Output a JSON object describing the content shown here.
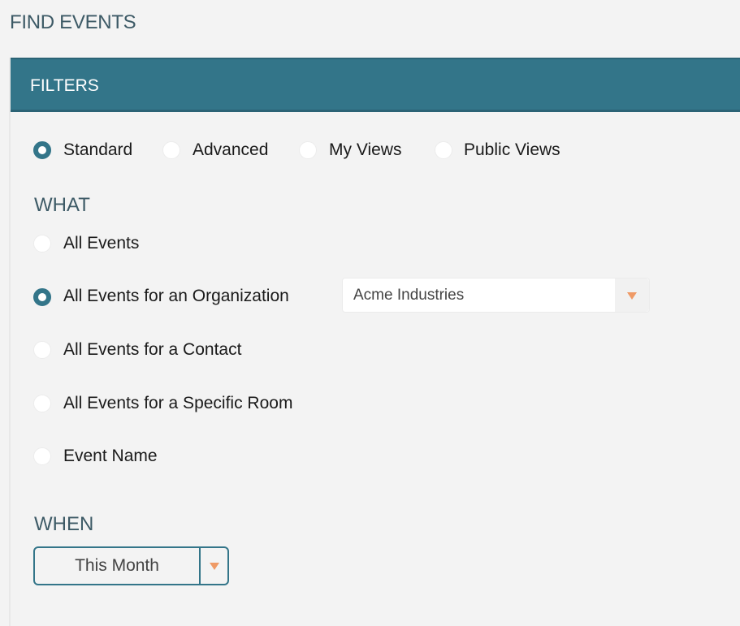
{
  "page": {
    "title": "FIND EVENTS"
  },
  "filters": {
    "header": "FILTERS",
    "mode_options": [
      {
        "label": "Standard",
        "checked": true
      },
      {
        "label": "Advanced",
        "checked": false
      },
      {
        "label": "My Views",
        "checked": false
      },
      {
        "label": "Public Views",
        "checked": false
      }
    ]
  },
  "what": {
    "title": "WHAT",
    "options": [
      {
        "label": "All Events",
        "checked": false
      },
      {
        "label": "All Events for an Organization",
        "checked": true
      },
      {
        "label": "All Events for a Contact",
        "checked": false
      },
      {
        "label": "All Events for a Specific Room",
        "checked": false
      },
      {
        "label": "Event Name",
        "checked": false
      }
    ],
    "organization_select": {
      "value": "Acme Industries",
      "icon": "caret-down-icon"
    }
  },
  "when": {
    "title": "WHEN",
    "select": {
      "value": "This Month",
      "icon": "caret-down-icon"
    }
  },
  "colors": {
    "accent": "#337589",
    "caret": "#ef9a66",
    "heading": "#3d5a66",
    "background": "#f3f3f3"
  }
}
